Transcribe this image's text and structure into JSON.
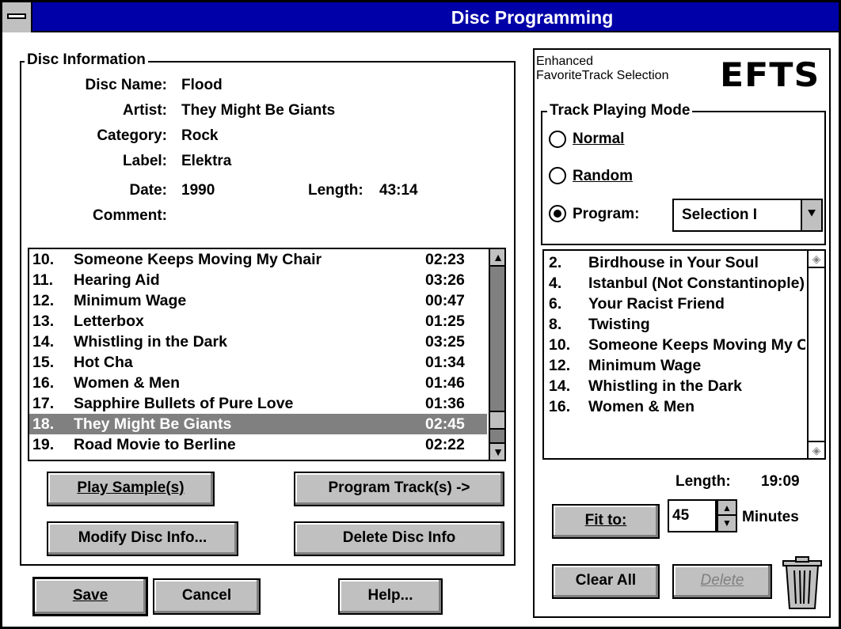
{
  "window": {
    "title": "Disc Programming"
  },
  "disc_info": {
    "group_title": "Disc Information",
    "labels": {
      "disc_name": "Disc Name:",
      "artist": "Artist:",
      "category": "Category:",
      "label": "Label:",
      "date": "Date:",
      "length": "Length:",
      "comment": "Comment:"
    },
    "values": {
      "disc_name": "Flood",
      "artist": "They Might Be Giants",
      "category": "Rock",
      "label": "Elektra",
      "date": "1990",
      "length": "43:14",
      "comment": ""
    }
  },
  "track_list": [
    {
      "num": "10.",
      "title": "Someone Keeps Moving My Chair",
      "time": "02:23"
    },
    {
      "num": "11.",
      "title": "Hearing Aid",
      "time": "03:26"
    },
    {
      "num": "12.",
      "title": "Minimum Wage",
      "time": "00:47"
    },
    {
      "num": "13.",
      "title": "Letterbox",
      "time": "01:25"
    },
    {
      "num": "14.",
      "title": "Whistling in the Dark",
      "time": "03:25"
    },
    {
      "num": "15.",
      "title": "Hot Cha",
      "time": "01:34"
    },
    {
      "num": "16.",
      "title": "Women & Men",
      "time": "01:46"
    },
    {
      "num": "17.",
      "title": "Sapphire Bullets of Pure Love",
      "time": "01:36"
    },
    {
      "num": "18.",
      "title": "They Might Be Giants",
      "time": "02:45",
      "selected": true
    },
    {
      "num": "19.",
      "title": "Road Movie to Berline",
      "time": "02:22"
    }
  ],
  "buttons": {
    "play_sample": "Play Sample(s)",
    "program_tracks": "Program Track(s) ->",
    "modify_disc_info": "Modify Disc Info...",
    "delete_disc_info": "Delete Disc Info",
    "save": "Save",
    "cancel": "Cancel",
    "help": "Help...",
    "fit_to": "Fit to:",
    "clear_all": "Clear All",
    "delete": "Delete"
  },
  "efts": {
    "line1": "Enhanced",
    "line2": "FavoriteTrack Selection",
    "logo": "EFTS"
  },
  "mode": {
    "group_title": "Track Playing Mode",
    "normal": "Normal",
    "random": "Random",
    "program": "Program:",
    "selected": "program",
    "program_select_value": "Selection I"
  },
  "program_list": [
    {
      "num": "2.",
      "title": "Birdhouse in Your Soul"
    },
    {
      "num": "4.",
      "title": "Istanbul (Not Constantinople)"
    },
    {
      "num": "6.",
      "title": "Your Racist Friend"
    },
    {
      "num": "8.",
      "title": "Twisting"
    },
    {
      "num": "10.",
      "title": "Someone Keeps Moving My Chair"
    },
    {
      "num": "12.",
      "title": "Minimum Wage"
    },
    {
      "num": "14.",
      "title": "Whistling in the Dark"
    },
    {
      "num": "16.",
      "title": "Women & Men"
    }
  ],
  "program_length": {
    "label": "Length:",
    "value": "19:09"
  },
  "fit": {
    "minutes_value": "45",
    "minutes_label": "Minutes"
  },
  "icons": {
    "system_menu": "system-menu-icon",
    "trash": "trash-can-icon",
    "scroll_up": "up-arrow-icon",
    "scroll_down": "down-arrow-icon",
    "dropdown": "dropdown-arrow-icon"
  }
}
